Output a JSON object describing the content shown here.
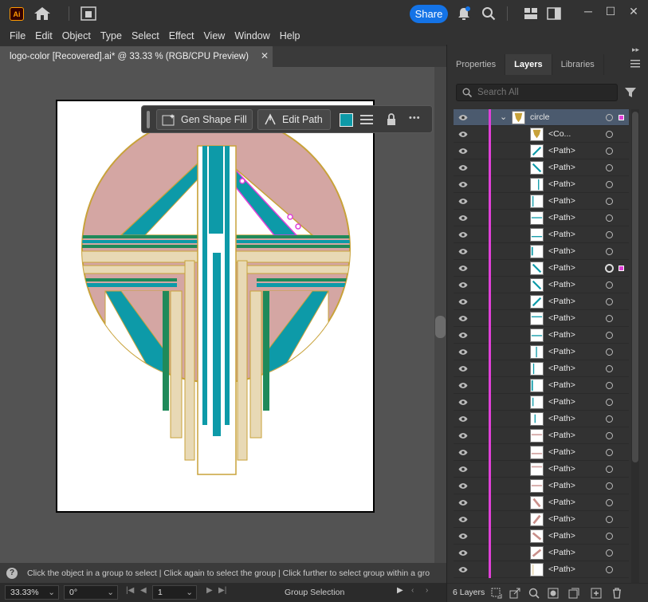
{
  "app": {
    "logo_text": "Ai",
    "share_label": "Share"
  },
  "menu": [
    "File",
    "Edit",
    "Object",
    "Type",
    "Select",
    "Effect",
    "View",
    "Window",
    "Help"
  ],
  "document": {
    "tab_title": "logo-color [Recovered].ai* @ 33.33 % (RGB/CPU Preview)",
    "close_glyph": "✕"
  },
  "context_bar": {
    "gen_shape_fill": "Gen Shape Fill",
    "edit_path": "Edit Path",
    "more_glyph": "•••",
    "swatch_color": "#0d9aa8"
  },
  "status": {
    "hint": "Click the object in a group to select  |  Click again to select the group  |  Click further to select group within a gro",
    "zoom": "33.33%",
    "rotation": "0°",
    "artboard_number": "1",
    "tool": "Group Selection"
  },
  "panel": {
    "tabs": [
      "Properties",
      "Layers",
      "Libraries"
    ],
    "active_tab": "Layers",
    "search_placeholder": "Search All",
    "layer_count": "6 Layers",
    "collapse_glyph": "▸▸"
  },
  "layers": [
    {
      "name": "circle",
      "kind": "group",
      "selected_square": true
    },
    {
      "name": "<Co...",
      "kind": "child"
    },
    {
      "name": "<Path>",
      "kind": "child"
    },
    {
      "name": "<Path>",
      "kind": "child"
    },
    {
      "name": "<Path>",
      "kind": "child"
    },
    {
      "name": "<Path>",
      "kind": "child"
    },
    {
      "name": "<Path>",
      "kind": "child"
    },
    {
      "name": "<Path>",
      "kind": "child"
    },
    {
      "name": "<Path>",
      "kind": "child"
    },
    {
      "name": "<Path>",
      "kind": "child",
      "targeted": true
    },
    {
      "name": "<Path>",
      "kind": "child"
    },
    {
      "name": "<Path>",
      "kind": "child"
    },
    {
      "name": "<Path>",
      "kind": "child"
    },
    {
      "name": "<Path>",
      "kind": "child"
    },
    {
      "name": "<Path>",
      "kind": "child"
    },
    {
      "name": "<Path>",
      "kind": "child"
    },
    {
      "name": "<Path>",
      "kind": "child"
    },
    {
      "name": "<Path>",
      "kind": "child"
    },
    {
      "name": "<Path>",
      "kind": "child"
    },
    {
      "name": "<Path>",
      "kind": "child"
    },
    {
      "name": "<Path>",
      "kind": "child"
    },
    {
      "name": "<Path>",
      "kind": "child"
    },
    {
      "name": "<Path>",
      "kind": "child"
    },
    {
      "name": "<Path>",
      "kind": "child"
    },
    {
      "name": "<Path>",
      "kind": "child"
    },
    {
      "name": "<Path>",
      "kind": "child"
    },
    {
      "name": "<Path>",
      "kind": "child"
    },
    {
      "name": "<Path>",
      "kind": "child"
    }
  ],
  "colors": {
    "teal": "#0d9aa8",
    "rose": "#d4a6a3",
    "gold": "#c8a23a",
    "beige": "#e8d9b5",
    "green": "#1f8a5a",
    "selection": "#e040d8",
    "accent_blue": "#1473e6"
  }
}
